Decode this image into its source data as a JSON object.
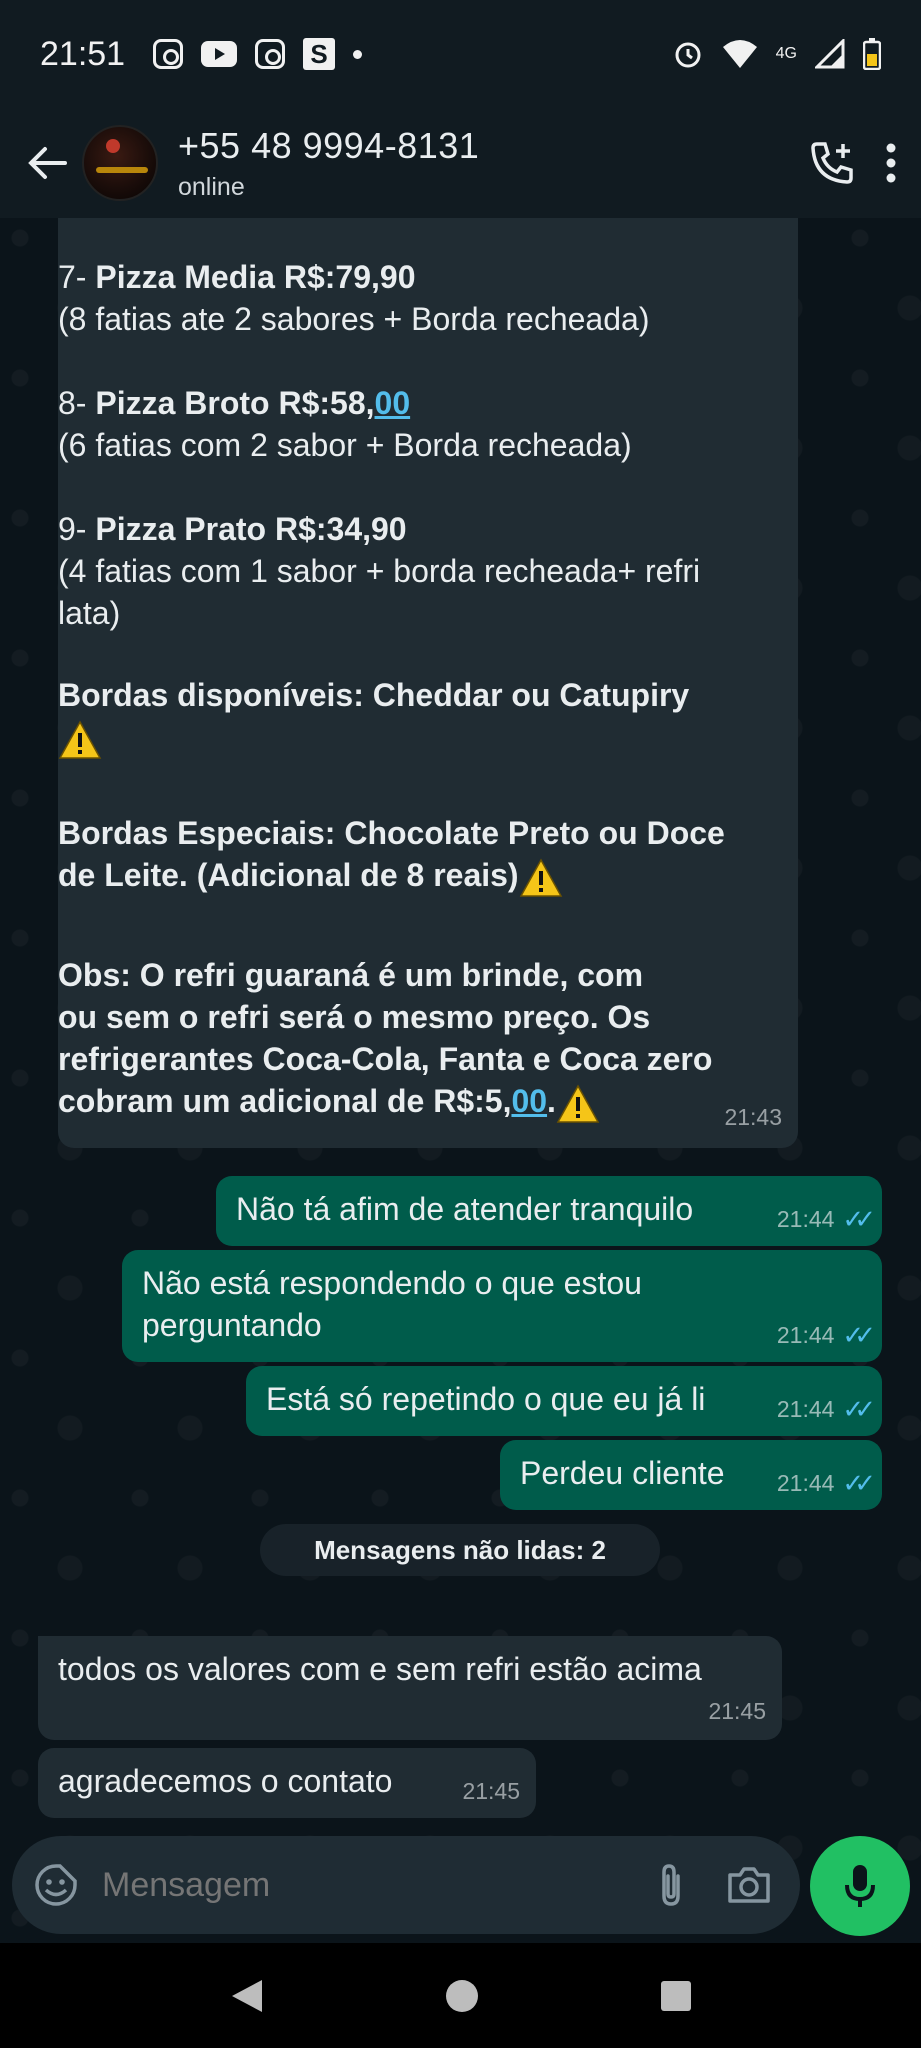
{
  "status_bar": {
    "time": "21:51",
    "network": "4G"
  },
  "header": {
    "contact_name": "+55 48 9994-8131",
    "contact_status": "online"
  },
  "menu_message": {
    "item7_title": "Pizza Media R$:79,90",
    "item7_prefix": "7- ",
    "item7_desc": "(8 fatias ate 2 sabores + Borda recheada)",
    "item8_prefix": "8- ",
    "item8_title": "Pizza Broto R$:58,",
    "item8_cents": "00",
    "item8_desc": "(6 fatias com 2 sabor + Borda recheada)",
    "item9_prefix": "9- ",
    "item9_title": "Pizza Prato R$:34,90",
    "item9_desc1": "(4 fatias com 1 sabor + borda recheada+ refri",
    "item9_desc2": "lata)",
    "bordas": "Bordas disponíveis: Cheddar ou Catupiry",
    "especiais1": "Bordas Especiais: Chocolate Preto ou Doce",
    "especiais2": "de Leite. (Adicional de 8 reais)",
    "obs1": "Obs: O refri guaraná é um brinde, com",
    "obs2": "ou sem o refri será o mesmo preço. Os",
    "obs3": "refrigerantes Coca-Cola, Fanta e Coca zero",
    "obs4": "cobram um adicional de R$:5,",
    "obs4_cents": "00",
    "obs4_end": ".",
    "time": "21:43"
  },
  "outgoing": [
    {
      "text": "Não tá afim de atender tranquilo",
      "time": "21:44"
    },
    {
      "text1": "Não está respondendo o que estou",
      "text2": "perguntando",
      "time": "21:44"
    },
    {
      "text": "Está só repetindo o que eu já li",
      "time": "21:44"
    },
    {
      "text": "Perdeu cliente",
      "time": "21:44"
    }
  ],
  "unread_label": "Mensagens não lidas: 2",
  "incoming": [
    {
      "text": "todos os valores com e sem refri estão acima",
      "time": "21:45"
    },
    {
      "text": "agradecemos o contato",
      "time": "21:45"
    }
  ],
  "composer": {
    "placeholder": "Mensagem"
  },
  "colors": {
    "incoming_bubble": "#202c33",
    "outgoing_bubble": "#005c4b",
    "accent": "#21c063",
    "read_ticks": "#53bdeb"
  }
}
